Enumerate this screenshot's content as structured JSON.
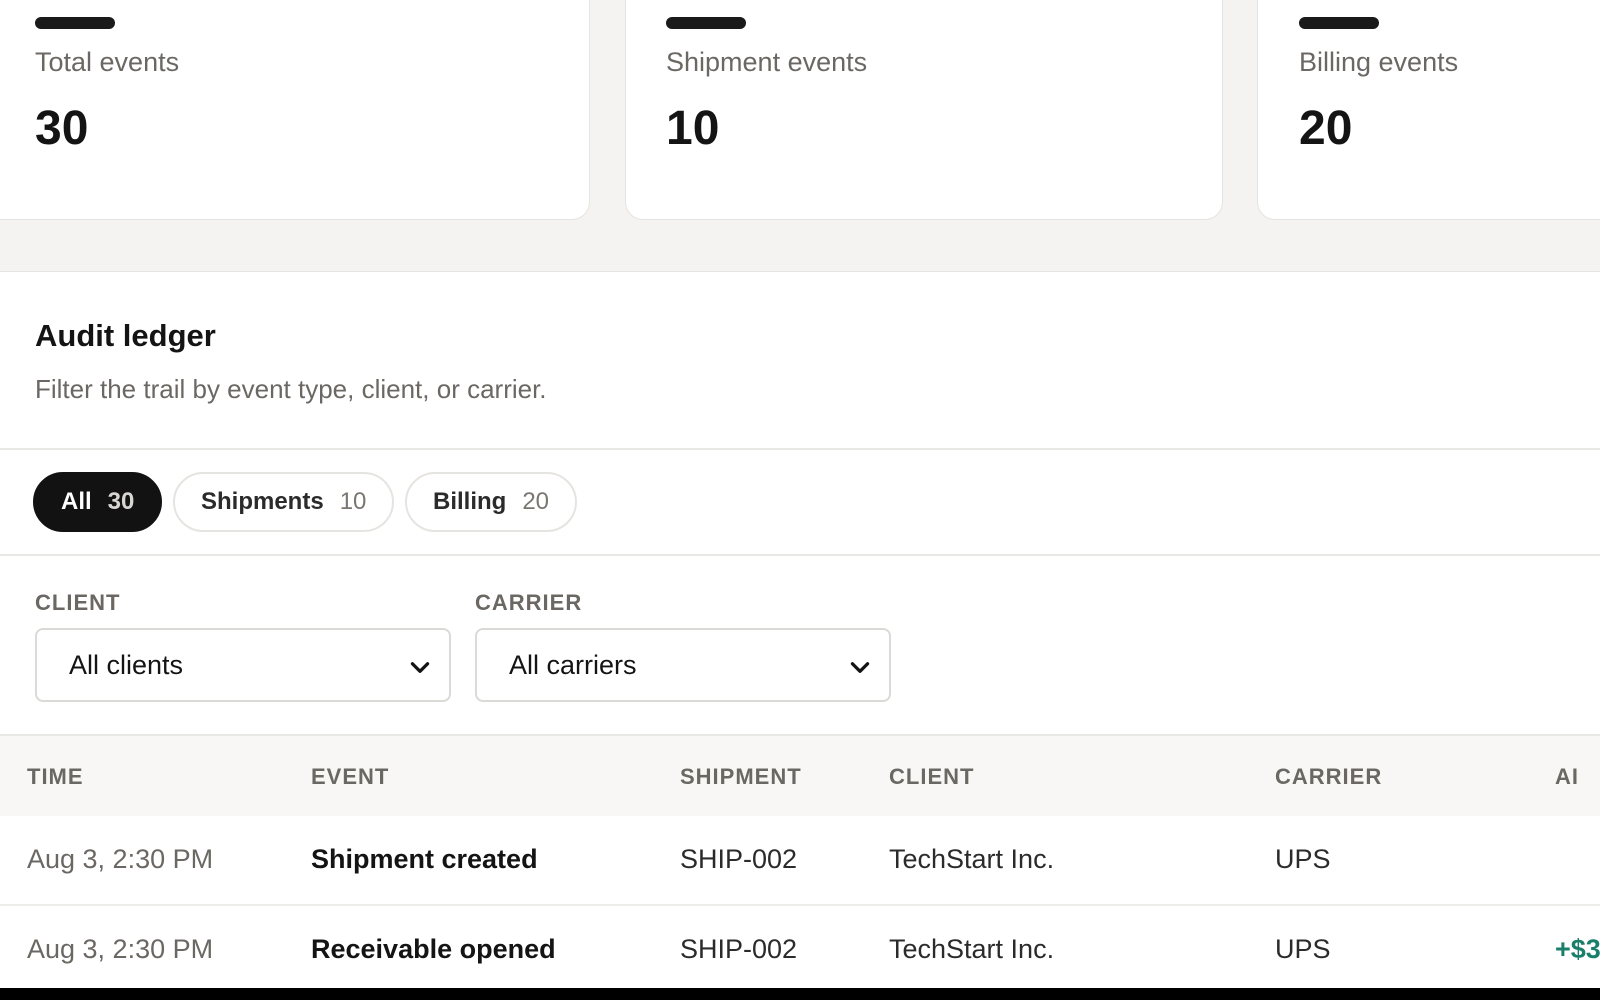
{
  "stats": [
    {
      "label": "Total events",
      "value": "30"
    },
    {
      "label": "Shipment events",
      "value": "10"
    },
    {
      "label": "Billing events",
      "value": "20"
    }
  ],
  "ledger": {
    "title": "Audit ledger",
    "subtitle": "Filter the trail by event type, client, or carrier."
  },
  "tabs": [
    {
      "label": "All",
      "count": "30",
      "active": true
    },
    {
      "label": "Shipments",
      "count": "10",
      "active": false
    },
    {
      "label": "Billing",
      "count": "20",
      "active": false
    }
  ],
  "filters": {
    "client": {
      "label": "CLIENT",
      "value": "All clients"
    },
    "carrier": {
      "label": "CARRIER",
      "value": "All carriers"
    }
  },
  "table": {
    "columns": [
      "TIME",
      "EVENT",
      "SHIPMENT",
      "CLIENT",
      "CARRIER",
      "AI"
    ],
    "rows": [
      {
        "time": "Aug 3, 2:30 PM",
        "event": "Shipment created",
        "shipment": "SHIP-002",
        "client": "TechStart Inc.",
        "carrier": "UPS",
        "amount": ""
      },
      {
        "time": "Aug 3, 2:30 PM",
        "event": "Receivable opened",
        "shipment": "SHIP-002",
        "client": "TechStart Inc.",
        "carrier": "UPS",
        "amount": "+$3"
      }
    ]
  },
  "colors": {
    "background": "#f4f3f1",
    "accent_dark": "#121212",
    "amount_positive": "#1a7f6a"
  },
  "icons": {
    "select_chevron": "chevron-down-icon"
  }
}
